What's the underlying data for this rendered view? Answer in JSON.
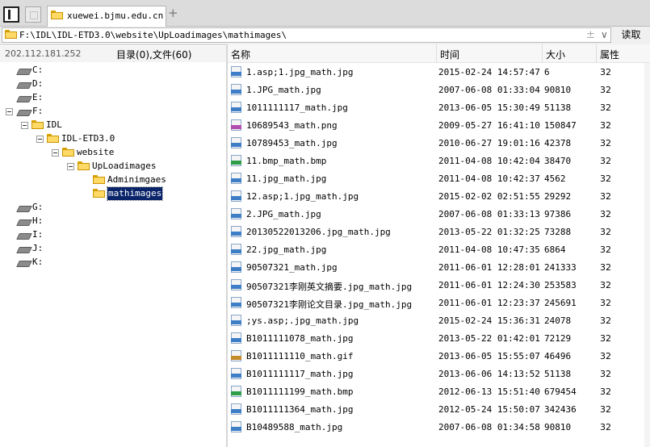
{
  "tabs": [
    {
      "label": "xuewei.bjmu.edu.cn"
    }
  ],
  "address": {
    "path": "F:\\IDL\\IDL-ETD3.0\\website\\UpLoadimages\\mathimages\\",
    "plus": "±",
    "dropdown": "∨",
    "read_label": "读取"
  },
  "info": {
    "ip": "202.112.181.252",
    "counts": "目录(0),文件(60)"
  },
  "tree": [
    {
      "label": "C:",
      "type": "drive",
      "level": 0
    },
    {
      "label": "D:",
      "type": "drive",
      "level": 0
    },
    {
      "label": "E:",
      "type": "drive",
      "level": 0
    },
    {
      "label": "F:",
      "type": "drive",
      "level": 0,
      "expanded": true
    },
    {
      "label": "IDL",
      "type": "folder",
      "level": 1,
      "expanded": true
    },
    {
      "label": "IDL-ETD3.0",
      "type": "folder",
      "level": 2,
      "expanded": true
    },
    {
      "label": "website",
      "type": "folder",
      "level": 3,
      "expanded": true
    },
    {
      "label": "UpLoadimages",
      "type": "folder",
      "level": 4,
      "expanded": true
    },
    {
      "label": "Adminimgaes",
      "type": "folder",
      "level": 5
    },
    {
      "label": "mathimages",
      "type": "folder",
      "level": 5,
      "selected": true
    },
    {
      "label": "G:",
      "type": "drive",
      "level": 0
    },
    {
      "label": "H:",
      "type": "drive",
      "level": 0
    },
    {
      "label": "I:",
      "type": "drive",
      "level": 0
    },
    {
      "label": "J:",
      "type": "drive",
      "level": 0
    },
    {
      "label": "K:",
      "type": "drive",
      "level": 0
    }
  ],
  "columns": [
    "名称",
    "时间",
    "大小",
    "属性"
  ],
  "files": [
    {
      "icon": "jpg",
      "name": "1.asp;1.jpg_math.jpg",
      "time": "2015-02-24 14:57:47",
      "size": "6",
      "attr": "32"
    },
    {
      "icon": "jpg",
      "name": "1.JPG_math.jpg",
      "time": "2007-06-08 01:33:04",
      "size": "90810",
      "attr": "32"
    },
    {
      "icon": "jpg",
      "name": "1011111117_math.jpg",
      "time": "2013-06-05 15:30:49",
      "size": "51138",
      "attr": "32"
    },
    {
      "icon": "png",
      "name": "10689543_math.png",
      "time": "2009-05-27 16:41:10",
      "size": "150847",
      "attr": "32"
    },
    {
      "icon": "jpg",
      "name": "10789453_math.jpg",
      "time": "2010-06-27 19:01:16",
      "size": "42378",
      "attr": "32"
    },
    {
      "icon": "bmp",
      "name": "11.bmp_math.bmp",
      "time": "2011-04-08 10:42:04",
      "size": "38470",
      "attr": "32"
    },
    {
      "icon": "jpg",
      "name": "11.jpg_math.jpg",
      "time": "2011-04-08 10:42:37",
      "size": "4562",
      "attr": "32"
    },
    {
      "icon": "jpg",
      "name": "12.asp;1.jpg_math.jpg",
      "time": "2015-02-02 02:51:55",
      "size": "29292",
      "attr": "32"
    },
    {
      "icon": "jpg",
      "name": "2.JPG_math.jpg",
      "time": "2007-06-08 01:33:13",
      "size": "97386",
      "attr": "32"
    },
    {
      "icon": "jpg",
      "name": "20130522013206.jpg_math.jpg",
      "time": "2013-05-22 01:32:25",
      "size": "73288",
      "attr": "32"
    },
    {
      "icon": "jpg",
      "name": "22.jpg_math.jpg",
      "time": "2011-04-08 10:47:35",
      "size": "6864",
      "attr": "32"
    },
    {
      "icon": "jpg",
      "name": "90507321_math.jpg",
      "time": "2011-06-01 12:28:01",
      "size": "241333",
      "attr": "32"
    },
    {
      "icon": "jpg",
      "name": "90507321李刚英文摘要.jpg_math.jpg",
      "time": "2011-06-01 12:24:30",
      "size": "253583",
      "attr": "32"
    },
    {
      "icon": "jpg",
      "name": "90507321李刚论文目录.jpg_math.jpg",
      "time": "2011-06-01 12:23:37",
      "size": "245691",
      "attr": "32"
    },
    {
      "icon": "jpg",
      "name": ";ys.asp;.jpg_math.jpg",
      "time": "2015-02-24 15:36:31",
      "size": "24078",
      "attr": "32"
    },
    {
      "icon": "jpg",
      "name": "B1011111078_math.jpg",
      "time": "2013-05-22 01:42:01",
      "size": "72129",
      "attr": "32"
    },
    {
      "icon": "gif",
      "name": "B1011111110_math.gif",
      "time": "2013-06-05 15:55:07",
      "size": "46496",
      "attr": "32"
    },
    {
      "icon": "jpg",
      "name": "B1011111117_math.jpg",
      "time": "2013-06-06 14:13:52",
      "size": "51138",
      "attr": "32"
    },
    {
      "icon": "bmp",
      "name": "B1011111199_math.bmp",
      "time": "2012-06-13 15:51:40",
      "size": "679454",
      "attr": "32"
    },
    {
      "icon": "jpg",
      "name": "B1011111364_math.jpg",
      "time": "2012-05-24 15:50:07",
      "size": "342436",
      "attr": "32"
    },
    {
      "icon": "jpg",
      "name": "B10489588_math.jpg",
      "time": "2007-06-08 01:34:58",
      "size": "90810",
      "attr": "32"
    }
  ]
}
